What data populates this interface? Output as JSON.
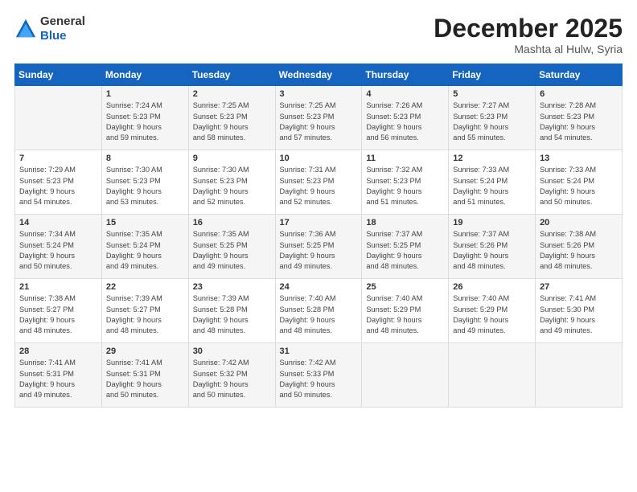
{
  "header": {
    "logo_line1": "General",
    "logo_line2": "Blue",
    "month_title": "December 2025",
    "location": "Mashta al Hulw, Syria"
  },
  "days_of_week": [
    "Sunday",
    "Monday",
    "Tuesday",
    "Wednesday",
    "Thursday",
    "Friday",
    "Saturday"
  ],
  "weeks": [
    [
      {
        "day": "",
        "content": ""
      },
      {
        "day": "1",
        "content": "Sunrise: 7:24 AM\nSunset: 5:23 PM\nDaylight: 9 hours\nand 59 minutes."
      },
      {
        "day": "2",
        "content": "Sunrise: 7:25 AM\nSunset: 5:23 PM\nDaylight: 9 hours\nand 58 minutes."
      },
      {
        "day": "3",
        "content": "Sunrise: 7:25 AM\nSunset: 5:23 PM\nDaylight: 9 hours\nand 57 minutes."
      },
      {
        "day": "4",
        "content": "Sunrise: 7:26 AM\nSunset: 5:23 PM\nDaylight: 9 hours\nand 56 minutes."
      },
      {
        "day": "5",
        "content": "Sunrise: 7:27 AM\nSunset: 5:23 PM\nDaylight: 9 hours\nand 55 minutes."
      },
      {
        "day": "6",
        "content": "Sunrise: 7:28 AM\nSunset: 5:23 PM\nDaylight: 9 hours\nand 54 minutes."
      }
    ],
    [
      {
        "day": "7",
        "content": "Sunrise: 7:29 AM\nSunset: 5:23 PM\nDaylight: 9 hours\nand 54 minutes."
      },
      {
        "day": "8",
        "content": "Sunrise: 7:30 AM\nSunset: 5:23 PM\nDaylight: 9 hours\nand 53 minutes."
      },
      {
        "day": "9",
        "content": "Sunrise: 7:30 AM\nSunset: 5:23 PM\nDaylight: 9 hours\nand 52 minutes."
      },
      {
        "day": "10",
        "content": "Sunrise: 7:31 AM\nSunset: 5:23 PM\nDaylight: 9 hours\nand 52 minutes."
      },
      {
        "day": "11",
        "content": "Sunrise: 7:32 AM\nSunset: 5:23 PM\nDaylight: 9 hours\nand 51 minutes."
      },
      {
        "day": "12",
        "content": "Sunrise: 7:33 AM\nSunset: 5:24 PM\nDaylight: 9 hours\nand 51 minutes."
      },
      {
        "day": "13",
        "content": "Sunrise: 7:33 AM\nSunset: 5:24 PM\nDaylight: 9 hours\nand 50 minutes."
      }
    ],
    [
      {
        "day": "14",
        "content": "Sunrise: 7:34 AM\nSunset: 5:24 PM\nDaylight: 9 hours\nand 50 minutes."
      },
      {
        "day": "15",
        "content": "Sunrise: 7:35 AM\nSunset: 5:24 PM\nDaylight: 9 hours\nand 49 minutes."
      },
      {
        "day": "16",
        "content": "Sunrise: 7:35 AM\nSunset: 5:25 PM\nDaylight: 9 hours\nand 49 minutes."
      },
      {
        "day": "17",
        "content": "Sunrise: 7:36 AM\nSunset: 5:25 PM\nDaylight: 9 hours\nand 49 minutes."
      },
      {
        "day": "18",
        "content": "Sunrise: 7:37 AM\nSunset: 5:25 PM\nDaylight: 9 hours\nand 48 minutes."
      },
      {
        "day": "19",
        "content": "Sunrise: 7:37 AM\nSunset: 5:26 PM\nDaylight: 9 hours\nand 48 minutes."
      },
      {
        "day": "20",
        "content": "Sunrise: 7:38 AM\nSunset: 5:26 PM\nDaylight: 9 hours\nand 48 minutes."
      }
    ],
    [
      {
        "day": "21",
        "content": "Sunrise: 7:38 AM\nSunset: 5:27 PM\nDaylight: 9 hours\nand 48 minutes."
      },
      {
        "day": "22",
        "content": "Sunrise: 7:39 AM\nSunset: 5:27 PM\nDaylight: 9 hours\nand 48 minutes."
      },
      {
        "day": "23",
        "content": "Sunrise: 7:39 AM\nSunset: 5:28 PM\nDaylight: 9 hours\nand 48 minutes."
      },
      {
        "day": "24",
        "content": "Sunrise: 7:40 AM\nSunset: 5:28 PM\nDaylight: 9 hours\nand 48 minutes."
      },
      {
        "day": "25",
        "content": "Sunrise: 7:40 AM\nSunset: 5:29 PM\nDaylight: 9 hours\nand 48 minutes."
      },
      {
        "day": "26",
        "content": "Sunrise: 7:40 AM\nSunset: 5:29 PM\nDaylight: 9 hours\nand 49 minutes."
      },
      {
        "day": "27",
        "content": "Sunrise: 7:41 AM\nSunset: 5:30 PM\nDaylight: 9 hours\nand 49 minutes."
      }
    ],
    [
      {
        "day": "28",
        "content": "Sunrise: 7:41 AM\nSunset: 5:31 PM\nDaylight: 9 hours\nand 49 minutes."
      },
      {
        "day": "29",
        "content": "Sunrise: 7:41 AM\nSunset: 5:31 PM\nDaylight: 9 hours\nand 50 minutes."
      },
      {
        "day": "30",
        "content": "Sunrise: 7:42 AM\nSunset: 5:32 PM\nDaylight: 9 hours\nand 50 minutes."
      },
      {
        "day": "31",
        "content": "Sunrise: 7:42 AM\nSunset: 5:33 PM\nDaylight: 9 hours\nand 50 minutes."
      },
      {
        "day": "",
        "content": ""
      },
      {
        "day": "",
        "content": ""
      },
      {
        "day": "",
        "content": ""
      }
    ]
  ]
}
